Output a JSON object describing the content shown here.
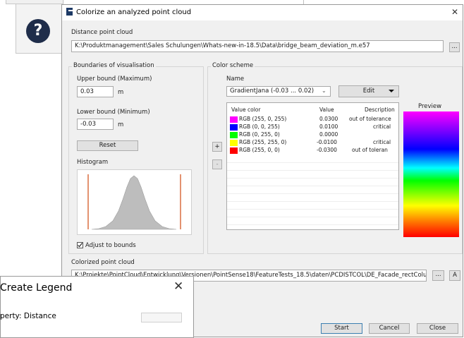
{
  "dialog": {
    "title": "Colorize an analyzed point cloud",
    "distance_cloud": {
      "label": "Distance point cloud",
      "path": "K:\\Produktmanagement\\Sales Schulungen\\Whats-new-in-18.5\\Data\\bridge_beam_deviation_m.e57",
      "browse_label": "..."
    },
    "boundaries": {
      "group_label": "Boundaries of visualisation",
      "upper_label": "Upper bound (Maximum)",
      "upper_value": "0.03",
      "upper_unit": "m",
      "lower_label": "Lower bound (Minimum)",
      "lower_value": "-0.03",
      "lower_unit": "m",
      "reset_label": "Reset",
      "histogram_label": "Histogram",
      "adjust_label": "Adjust to bounds",
      "adjust_checked": true
    },
    "color_scheme": {
      "group_label": "Color scheme",
      "name_label": "Name",
      "selected_scheme": "GradientJana (-0.03 ... 0.02)",
      "edit_label": "Edit",
      "preview_label": "Preview",
      "add_label": "+",
      "remove_label": "-",
      "columns": [
        "Value color",
        "Value",
        "Description"
      ],
      "rows": [
        {
          "color": "#ff00ff",
          "rgb": "RGB (255, 0, 255)",
          "value": "0.0300",
          "description": "out of tolerance"
        },
        {
          "color": "#0000ff",
          "rgb": "RGB (0, 0, 255)",
          "value": "0.0100",
          "description": "critical"
        },
        {
          "color": "#00ff00",
          "rgb": "RGB (0, 255, 0)",
          "value": "0.0000",
          "description": ""
        },
        {
          "color": "#ffff00",
          "rgb": "RGB (255, 255, 0)",
          "value": "-0.0100",
          "description": "critical"
        },
        {
          "color": "#ff0000",
          "rgb": "RGB (255, 0, 0)",
          "value": "-0.0300",
          "description": "out of toleran"
        }
      ]
    },
    "colorized_cloud": {
      "label": "Colorized point cloud",
      "path": "K:\\Projekte\\PointCloud\\Entwicklung\\Versionen\\PointSense18\\FeatureTests_18.5\\daten\\PCDISTCOL\\DE_Facade_rectColumn_dev",
      "browse_label": "...",
      "a_label": "A"
    },
    "buttons": {
      "start": "Start",
      "cancel": "Cancel",
      "close": "Close"
    }
  },
  "legend_window": {
    "title": "Create Legend",
    "close_label": "✕",
    "property_label": "perty: Distance"
  },
  "background": {
    "help_icon": "question-icon"
  },
  "colors": {
    "dialog_bg": "#f0f0f0",
    "accent_icon": "#1e3a66"
  }
}
